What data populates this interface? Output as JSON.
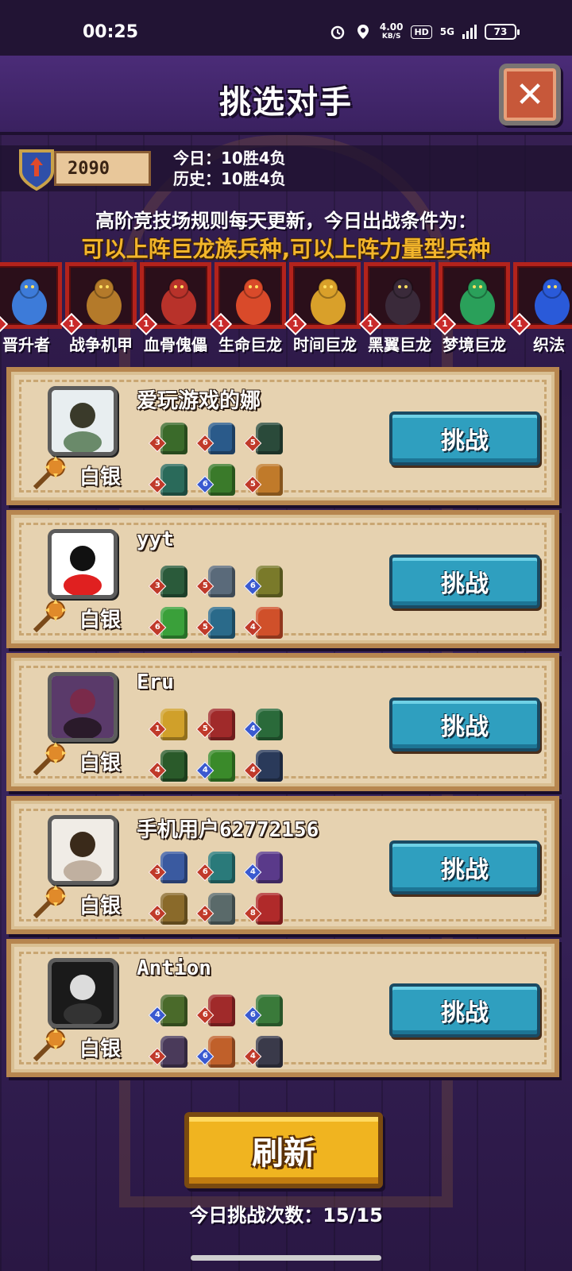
{
  "status_bar": {
    "time": "00:25",
    "net_speed": "4.00",
    "net_unit": "KB/S",
    "hd": "HD",
    "signal": "5G",
    "battery": "73"
  },
  "header": {
    "title": "挑选对手",
    "close_icon": "close-x-icon"
  },
  "player": {
    "rating": "2090",
    "today_record": "今日：10胜4负",
    "history_record": "历史：10胜4负"
  },
  "rules": {
    "line1": "高阶竞技场规则每天更新，今日出战条件为：",
    "line2": "可以上阵巨龙族兵种,可以上阵力量型兵种"
  },
  "allowed_units": [
    {
      "name": "晋升者",
      "level": "1",
      "color": "#3d7bd9"
    },
    {
      "name": "战争机甲",
      "level": "1",
      "color": "#b47a2a"
    },
    {
      "name": "血骨傀儡",
      "level": "1",
      "color": "#b8322a"
    },
    {
      "name": "生命巨龙",
      "level": "1",
      "color": "#d94a2a"
    },
    {
      "name": "时间巨龙",
      "level": "1",
      "color": "#d9a02a"
    },
    {
      "name": "黑翼巨龙",
      "level": "1",
      "color": "#3a2a3a"
    },
    {
      "name": "梦境巨龙",
      "level": "1",
      "color": "#2aa05a"
    },
    {
      "name": "织法",
      "level": "1",
      "color": "#2a5ad9"
    }
  ],
  "opponents": [
    {
      "name": "爱玩游戏的娜",
      "rank": "白银",
      "button": "挑战",
      "team": [
        {
          "level": "3",
          "color": "#3a6a2a"
        },
        {
          "level": "6",
          "color": "#2a5a8a"
        },
        {
          "level": "5",
          "color": "#2a4a3a"
        },
        {
          "level": "5",
          "color": "#2a6a5a"
        },
        {
          "level": "6",
          "color": "#3a7a2a"
        },
        {
          "level": "5",
          "color": "#c07a2a"
        }
      ]
    },
    {
      "name": "yyt",
      "rank": "白银",
      "button": "挑战",
      "team": [
        {
          "level": "3",
          "color": "#2a5a3a"
        },
        {
          "level": "5",
          "color": "#5a6a7a"
        },
        {
          "level": "6",
          "color": "#7a7a2a"
        },
        {
          "level": "6",
          "color": "#3aa03a"
        },
        {
          "level": "5",
          "color": "#2a6a8a"
        },
        {
          "level": "4",
          "color": "#d0502a"
        }
      ]
    },
    {
      "name": "Eru",
      "rank": "白银",
      "button": "挑战",
      "team": [
        {
          "level": "1",
          "color": "#d0a02a"
        },
        {
          "level": "5",
          "color": "#a02a2a"
        },
        {
          "level": "4",
          "color": "#2a6a3a"
        },
        {
          "level": "4",
          "color": "#2a5a2a"
        },
        {
          "level": "4",
          "color": "#3a8a2a"
        },
        {
          "level": "4",
          "color": "#2a3a5a"
        }
      ]
    },
    {
      "name": "手机用户62772156",
      "rank": "白银",
      "button": "挑战",
      "team": [
        {
          "level": "3",
          "color": "#3a5aa0"
        },
        {
          "level": "6",
          "color": "#2a7a7a"
        },
        {
          "level": "4",
          "color": "#5a3a8a"
        },
        {
          "level": "6",
          "color": "#8a6a2a"
        },
        {
          "level": "5",
          "color": "#5a6a6a"
        },
        {
          "level": "8",
          "color": "#b02a2a"
        }
      ]
    },
    {
      "name": "Antion",
      "rank": "白银",
      "button": "挑战",
      "team": [
        {
          "level": "4",
          "color": "#4a6a2a"
        },
        {
          "level": "6",
          "color": "#a02a2a"
        },
        {
          "level": "6",
          "color": "#3a7a3a"
        },
        {
          "level": "5",
          "color": "#4a3a5a"
        },
        {
          "level": "6",
          "color": "#c0602a"
        },
        {
          "level": "4",
          "color": "#3a3a4a"
        }
      ]
    }
  ],
  "footer": {
    "refresh": "刷新",
    "challenge_count": "今日挑战次数：15/15"
  }
}
